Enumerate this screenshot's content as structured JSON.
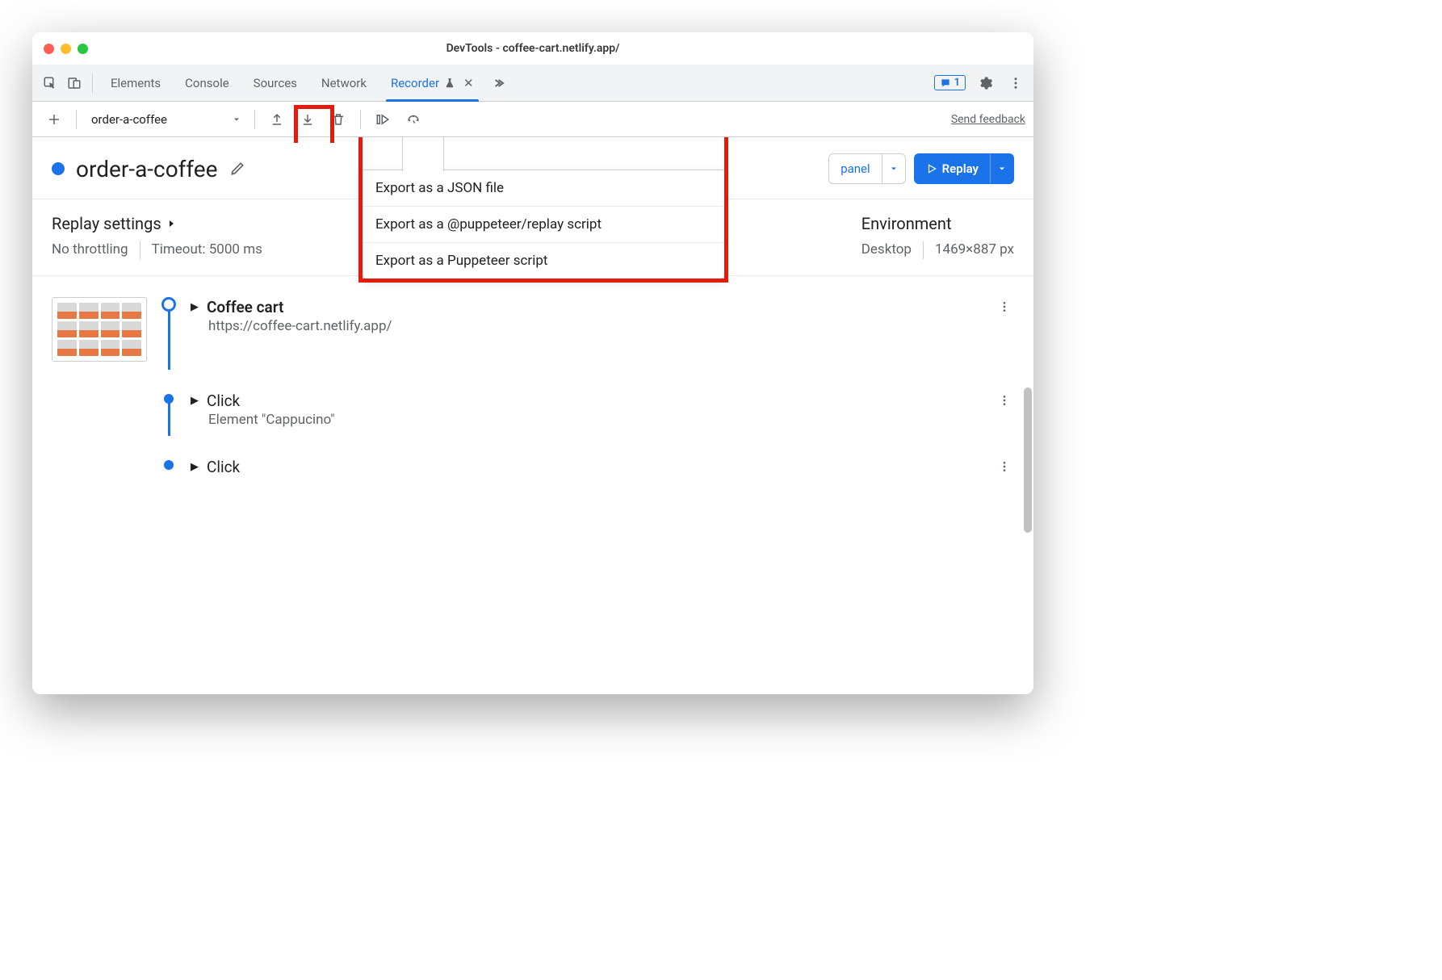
{
  "window": {
    "title": "DevTools - coffee-cart.netlify.app/"
  },
  "tabs": {
    "items": [
      "Elements",
      "Console",
      "Sources",
      "Network",
      "Recorder"
    ],
    "activeIndex": 4,
    "errorsBadge": "1"
  },
  "toolbar": {
    "recordingName": "order-a-coffee",
    "feedback": "Send feedback"
  },
  "exportMenu": {
    "items": [
      "Export as a JSON file",
      "Export as a @puppeteer/replay script",
      "Export as a Puppeteer script"
    ]
  },
  "recording": {
    "title": "order-a-coffee",
    "panelButton": "panel",
    "replayButton": "Replay"
  },
  "replaySettings": {
    "heading": "Replay settings",
    "throttling": "No throttling",
    "timeout": "Timeout: 5000 ms"
  },
  "environment": {
    "heading": "Environment",
    "device": "Desktop",
    "dimensions": "1469×887 px"
  },
  "steps": [
    {
      "title": "Coffee cart",
      "sub": "https://coffee-cart.netlify.app/",
      "hasThumb": true,
      "markerLarge": true
    },
    {
      "title": "Click",
      "sub": "Element \"Cappucino\"",
      "hasThumb": false,
      "markerLarge": false
    },
    {
      "title": "Click",
      "sub": "",
      "hasThumb": false,
      "markerLarge": false
    }
  ]
}
